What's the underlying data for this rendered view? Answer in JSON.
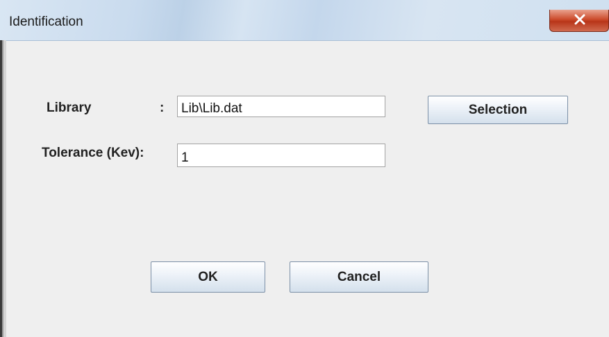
{
  "window": {
    "title": "Identification",
    "close_icon": "close-x-icon"
  },
  "form": {
    "library_label": "Library",
    "library_colon": ":",
    "library_value": "Lib\\Lib.dat",
    "tolerance_label": "Tolerance (Kev):",
    "tolerance_value": "1",
    "selection_label": "Selection"
  },
  "actions": {
    "ok_label": "OK",
    "cancel_label": "Cancel"
  },
  "colors": {
    "close_button": "#c7452a",
    "dialog_background": "#efefef",
    "button_gradient_bottom": "#d4e0ec"
  }
}
